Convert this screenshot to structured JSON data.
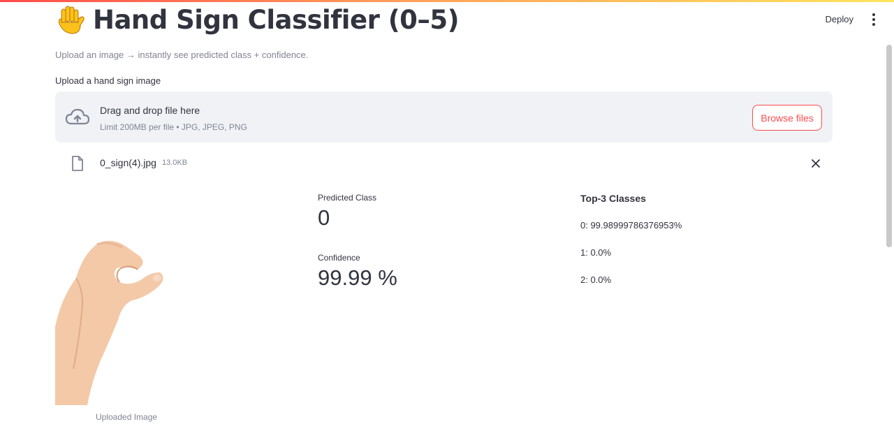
{
  "header": {
    "title_emoji": "raised-hand",
    "title": "Hand Sign Classifier (0–5)",
    "subtitle": "Upload an image → instantly see predicted class + confidence.",
    "deploy_label": "Deploy"
  },
  "uploader": {
    "label": "Upload a hand sign image",
    "drag_text": "Drag and drop file here",
    "limit_text": "Limit 200MB per file • JPG, JPEG, PNG",
    "browse_label": "Browse files"
  },
  "uploaded_file": {
    "name": "0_sign(4).jpg",
    "size": "13.0KB"
  },
  "image": {
    "caption": "Uploaded Image"
  },
  "prediction": {
    "class_label": "Predicted Class",
    "class_value": "0",
    "confidence_label": "Confidence",
    "confidence_value": "99.99 %"
  },
  "top3": {
    "title": "Top-3 Classes",
    "items": [
      "0: 99.98999786376953%",
      "1: 0.0%",
      "2: 0.0%"
    ]
  },
  "colors": {
    "accent": "#ff4b4b",
    "text": "#31333f",
    "muted": "#808495",
    "dropzone_bg": "#f0f2f6"
  },
  "icons": [
    "raised-hand-icon",
    "cloud-upload-icon",
    "file-icon",
    "close-icon",
    "more-vert-icon"
  ]
}
